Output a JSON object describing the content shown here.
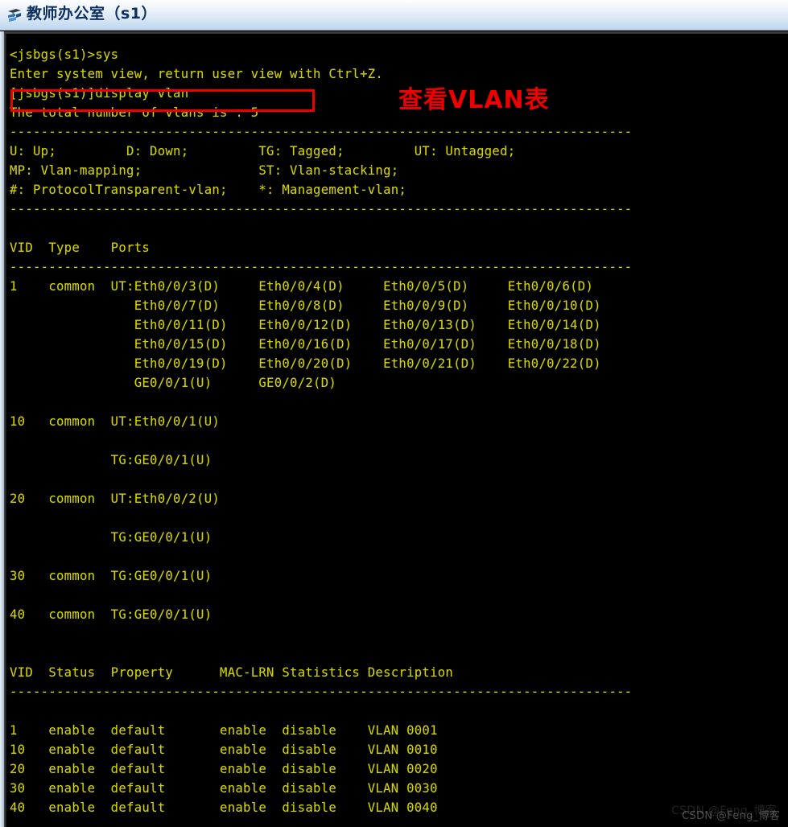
{
  "window": {
    "title": "教师办公室（s1）",
    "icon": "switch-icon"
  },
  "theme": {
    "terminal_background": "#000000",
    "terminal_text": "#d2d200",
    "annotation_red": "#ee0000",
    "titlebar_text": "#0d2f5e"
  },
  "annotations": {
    "highlight_box_target": "[jsbgs(s1)]display vlan",
    "note_text": "查看VLAN表"
  },
  "watermark": {
    "text": "CSDN @Feng_博客"
  },
  "terminal": {
    "prompt_line": "<jsbgs(s1)>sys",
    "system_view_msg": "Enter system view, return user view with Ctrl+Z.",
    "command_line": "[jsbgs(s1)]display vlan",
    "total_line": "The total number of vlans is : 5",
    "separator": "--------------------------------------------------------------------------------",
    "legend": [
      "U: Up;         D: Down;         TG: Tagged;         UT: Untagged;",
      "MP: Vlan-mapping;               ST: Vlan-stacking;",
      "#: ProtocolTransparent-vlan;    *: Management-vlan;"
    ],
    "ports_header": "VID  Type    Ports",
    "ports_rows": [
      "1    common  UT:Eth0/0/3(D)     Eth0/0/4(D)     Eth0/0/5(D)     Eth0/0/6(D)",
      "              Eth0/0/7(D)      Eth0/0/8(D)     Eth0/0/9(D)     Eth0/0/10(D)",
      "              Eth0/0/11(D)     Eth0/0/12(D)    Eth0/0/13(D)    Eth0/0/14(D)",
      "              Eth0/0/15(D)     Eth0/0/16(D)    Eth0/0/17(D)    Eth0/0/18(D)",
      "              Eth0/0/19(D)     Eth0/0/20(D)    Eth0/0/21(D)    Eth0/0/22(D)",
      "              GE0/0/1(U)       GE0/0/2(D)",
      "",
      "10   common  UT:Eth0/0/1(U)",
      "",
      "             TG:GE0/0/1(U)",
      "",
      "20   common  UT:Eth0/0/2(U)",
      "",
      "             TG:GE0/0/1(U)",
      "",
      "30   common  TG:GE0/0/1(U)",
      "",
      "40   common  TG:GE0/0/1(U)"
    ],
    "status_header": "VID  Status  Property      MAC-LRN Statistics Description",
    "status_rows": [
      "1    enable  default       enable  disable    VLAN 0001",
      "10   enable  default       enable  disable    VLAN 0010",
      "20   enable  default       enable  disable    VLAN 0020",
      "30   enable  default       enable  disable    VLAN 0030",
      "40   enable  default       enable  disable    VLAN 0040"
    ]
  },
  "vlan_table": {
    "columns": [
      "VID",
      "Status",
      "Property",
      "MAC-LRN",
      "Statistics",
      "Description"
    ],
    "rows": [
      {
        "vid": "1",
        "status": "enable",
        "property": "default",
        "mac_lrn": "enable",
        "statistics": "disable",
        "description": "VLAN 0001"
      },
      {
        "vid": "10",
        "status": "enable",
        "property": "default",
        "mac_lrn": "enable",
        "statistics": "disable",
        "description": "VLAN 0010"
      },
      {
        "vid": "20",
        "status": "enable",
        "property": "default",
        "mac_lrn": "enable",
        "statistics": "disable",
        "description": "VLAN 0020"
      },
      {
        "vid": "30",
        "status": "enable",
        "property": "default",
        "mac_lrn": "enable",
        "statistics": "disable",
        "description": "VLAN 0030"
      },
      {
        "vid": "40",
        "status": "enable",
        "property": "default",
        "mac_lrn": "enable",
        "statistics": "disable",
        "description": "VLAN 0040"
      }
    ]
  },
  "vlan_ports": {
    "columns": [
      "VID",
      "Type",
      "Ports"
    ],
    "rows": [
      {
        "vid": "1",
        "type": "common",
        "untagged": [
          "Eth0/0/3(D)",
          "Eth0/0/4(D)",
          "Eth0/0/5(D)",
          "Eth0/0/6(D)",
          "Eth0/0/7(D)",
          "Eth0/0/8(D)",
          "Eth0/0/9(D)",
          "Eth0/0/10(D)",
          "Eth0/0/11(D)",
          "Eth0/0/12(D)",
          "Eth0/0/13(D)",
          "Eth0/0/14(D)",
          "Eth0/0/15(D)",
          "Eth0/0/16(D)",
          "Eth0/0/17(D)",
          "Eth0/0/18(D)",
          "Eth0/0/19(D)",
          "Eth0/0/20(D)",
          "Eth0/0/21(D)",
          "Eth0/0/22(D)",
          "GE0/0/1(U)",
          "GE0/0/2(D)"
        ],
        "tagged": []
      },
      {
        "vid": "10",
        "type": "common",
        "untagged": [
          "Eth0/0/1(U)"
        ],
        "tagged": [
          "GE0/0/1(U)"
        ]
      },
      {
        "vid": "20",
        "type": "common",
        "untagged": [
          "Eth0/0/2(U)"
        ],
        "tagged": [
          "GE0/0/1(U)"
        ]
      },
      {
        "vid": "30",
        "type": "common",
        "untagged": [],
        "tagged": [
          "GE0/0/1(U)"
        ]
      },
      {
        "vid": "40",
        "type": "common",
        "untagged": [],
        "tagged": [
          "GE0/0/1(U)"
        ]
      }
    ]
  },
  "screen_text": "<jsbgs(s1)>sys\nEnter system view, return user view with Ctrl+Z.\n[jsbgs(s1)]display vlan\nThe total number of vlans is : 5\n--------------------------------------------------------------------------------\nU: Up;         D: Down;         TG: Tagged;         UT: Untagged;\nMP: Vlan-mapping;               ST: Vlan-stacking;\n#: ProtocolTransparent-vlan;    *: Management-vlan;\n--------------------------------------------------------------------------------\n\nVID  Type    Ports\n--------------------------------------------------------------------------------\n1    common  UT:Eth0/0/3(D)     Eth0/0/4(D)     Eth0/0/5(D)     Eth0/0/6(D)\n                Eth0/0/7(D)     Eth0/0/8(D)     Eth0/0/9(D)     Eth0/0/10(D)\n                Eth0/0/11(D)    Eth0/0/12(D)    Eth0/0/13(D)    Eth0/0/14(D)\n                Eth0/0/15(D)    Eth0/0/16(D)    Eth0/0/17(D)    Eth0/0/18(D)\n                Eth0/0/19(D)    Eth0/0/20(D)    Eth0/0/21(D)    Eth0/0/22(D)\n                GE0/0/1(U)      GE0/0/2(D)\n\n10   common  UT:Eth0/0/1(U)\n\n             TG:GE0/0/1(U)\n\n20   common  UT:Eth0/0/2(U)\n\n             TG:GE0/0/1(U)\n\n30   common  TG:GE0/0/1(U)\n\n40   common  TG:GE0/0/1(U)\n\n\nVID  Status  Property      MAC-LRN Statistics Description\n--------------------------------------------------------------------------------\n\n1    enable  default       enable  disable    VLAN 0001\n10   enable  default       enable  disable    VLAN 0010\n20   enable  default       enable  disable    VLAN 0020\n30   enable  default       enable  disable    VLAN 0030\n40   enable  default       enable  disable    VLAN 0040"
}
